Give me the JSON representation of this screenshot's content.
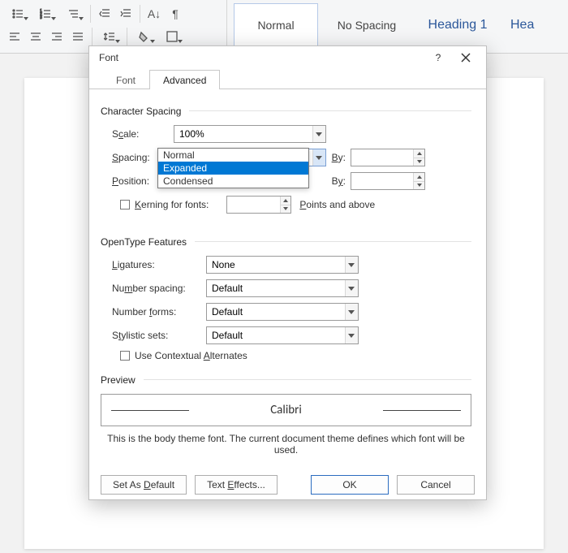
{
  "ribbon": {
    "styles": {
      "normal": "Normal",
      "no_spacing": "No Spacing",
      "heading1": "Heading 1",
      "heading2_partial": "Hea"
    }
  },
  "dialog": {
    "title": "Font",
    "help_tooltip": "?",
    "tabs": {
      "font": "Font",
      "advanced": "Advanced"
    },
    "char_spacing": {
      "heading": "Character Spacing",
      "scale_label_pre": "S",
      "scale_label_u": "c",
      "scale_label_post": "ale:",
      "scale_value": "100%",
      "spacing_label_pre": "",
      "spacing_label_u": "S",
      "spacing_label_post": "pacing:",
      "spacing_value": "Normal",
      "spacing_by_label_u": "B",
      "spacing_by_label_post": "y:",
      "spacing_by_value": "",
      "spacing_options": [
        "Normal",
        "Expanded",
        "Condensed"
      ],
      "spacing_highlight_index": 1,
      "position_label_pre": "",
      "position_label_u": "P",
      "position_label_post": "osition:",
      "position_by_label_pre": "B",
      "position_by_label_u": "y",
      "position_by_label_post": ":",
      "position_by_value": "",
      "kerning_label_pre": "",
      "kerning_label_u": "K",
      "kerning_label_post": "erning for fonts:",
      "kerning_units_pre": "",
      "kerning_units_u": "P",
      "kerning_units_post": "oints and above"
    },
    "opentype": {
      "heading": "OpenType Features",
      "ligatures_label_u": "L",
      "ligatures_label_post": "igatures:",
      "ligatures_value": "None",
      "num_spacing_label_pre": "Nu",
      "num_spacing_label_u": "m",
      "num_spacing_label_post": "ber spacing:",
      "num_spacing_value": "Default",
      "num_forms_label_pre": "Number ",
      "num_forms_label_u": "f",
      "num_forms_label_post": "orms:",
      "num_forms_value": "Default",
      "stylistic_label_pre": "S",
      "stylistic_label_u": "t",
      "stylistic_label_post": "ylistic sets:",
      "stylistic_value": "Default",
      "contextual_label_pre": "Use Contextual ",
      "contextual_label_u": "A",
      "contextual_label_post": "lternates"
    },
    "preview": {
      "heading": "Preview",
      "font_name": "Calibri",
      "caption": "This is the body theme font. The current document theme defines which font will be used."
    },
    "footer": {
      "set_default_pre": "Set As ",
      "set_default_u": "D",
      "set_default_post": "efault",
      "text_effects_pre": "Text ",
      "text_effects_u": "E",
      "text_effects_post": "ffects...",
      "ok": "OK",
      "cancel": "Cancel"
    }
  }
}
